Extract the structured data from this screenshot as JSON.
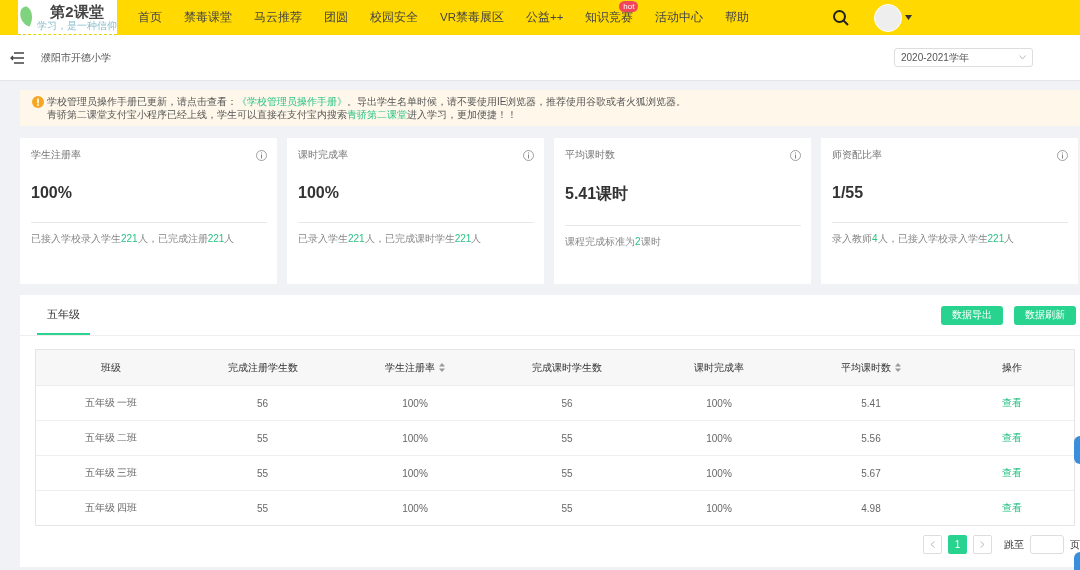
{
  "nav": {
    "logo": {
      "title": "第2课堂",
      "slogan": "学习，是一种信仰"
    },
    "items": [
      {
        "label": "首页"
      },
      {
        "label": "禁毒课堂"
      },
      {
        "label": "马云推荐"
      },
      {
        "label": "团圆"
      },
      {
        "label": "校园安全"
      },
      {
        "label": "VR禁毒展区"
      },
      {
        "label": "公益++"
      },
      {
        "label": "知识竞赛",
        "badge": "hot"
      },
      {
        "label": "活动中心"
      },
      {
        "label": "帮助"
      }
    ]
  },
  "subheader": {
    "school": "濮阳市开德小学",
    "year_select": {
      "value": "2020-2021学年"
    }
  },
  "notice": {
    "lines": [
      [
        {
          "kind": "text",
          "text": "学校管理员操作手册已更新，请点击查看："
        },
        {
          "kind": "link",
          "text": "《学校管理员操作手册》"
        },
        {
          "kind": "text",
          "text": "。导出学生名单时候，请不要使用IE浏览器，推荐使用谷歌或者火狐浏览器。"
        }
      ],
      [
        {
          "kind": "text",
          "text": "青骄第二课堂支付宝小程序已经上线，学生可以直接在支付宝内搜索"
        },
        {
          "kind": "link",
          "text": "青骄第二课堂"
        },
        {
          "kind": "text",
          "text": "进入学习，更加便捷！！"
        }
      ]
    ]
  },
  "stats": [
    {
      "title": "学生注册率",
      "value": "100%",
      "footer": [
        {
          "kind": "text",
          "text": "已接入学校录入学生"
        },
        {
          "kind": "number",
          "text": "221"
        },
        {
          "kind": "text",
          "text": "人，已完成注册"
        },
        {
          "kind": "number",
          "text": "221"
        },
        {
          "kind": "text",
          "text": "人"
        }
      ]
    },
    {
      "title": "课时完成率",
      "value": "100%",
      "footer": [
        {
          "kind": "text",
          "text": "已录入学生"
        },
        {
          "kind": "number",
          "text": "221"
        },
        {
          "kind": "text",
          "text": "人，已完成课时学生"
        },
        {
          "kind": "number",
          "text": "221"
        },
        {
          "kind": "text",
          "text": "人"
        }
      ]
    },
    {
      "title": "平均课时数",
      "value": "5.41课时",
      "footer": [
        {
          "kind": "text",
          "text": "课程完成标准为"
        },
        {
          "kind": "number",
          "text": "2"
        },
        {
          "kind": "text",
          "text": "课时"
        }
      ]
    },
    {
      "title": "师资配比率",
      "value": "1/55",
      "footer": [
        {
          "kind": "text",
          "text": "录入教师"
        },
        {
          "kind": "number",
          "text": "4"
        },
        {
          "kind": "text",
          "text": "人，已接入学校录入学生"
        },
        {
          "kind": "number",
          "text": "221"
        },
        {
          "kind": "text",
          "text": "人"
        }
      ]
    }
  ],
  "tabs": [
    {
      "label": "五年级",
      "selected": true
    }
  ],
  "buttons": [
    "数据导出",
    "数据刷新"
  ],
  "table": {
    "columns": [
      {
        "label": "班级",
        "kind": "plain"
      },
      {
        "label": "完成注册学生数",
        "kind": "plain"
      },
      {
        "label": "学生注册率",
        "kind": "sortable"
      },
      {
        "label": "完成课时学生数",
        "kind": "plain"
      },
      {
        "label": "课时完成率",
        "kind": "plain"
      },
      {
        "label": "平均课时数",
        "kind": "sortable"
      },
      {
        "label": "操作",
        "kind": "plain"
      }
    ],
    "rows": [
      [
        "五年级 一班",
        "56",
        "100%",
        "56",
        "100%",
        "5.41",
        "查看"
      ],
      [
        "五年级 二班",
        "55",
        "100%",
        "55",
        "100%",
        "5.56",
        "查看"
      ],
      [
        "五年级 三班",
        "55",
        "100%",
        "55",
        "100%",
        "5.67",
        "查看"
      ],
      [
        "五年级 四班",
        "55",
        "100%",
        "55",
        "100%",
        "4.98",
        "查看"
      ]
    ]
  },
  "pagination": {
    "pages": [
      {
        "label": "1",
        "selected": true
      }
    ],
    "jump_label": "跳至",
    "page_suffix": "页"
  }
}
